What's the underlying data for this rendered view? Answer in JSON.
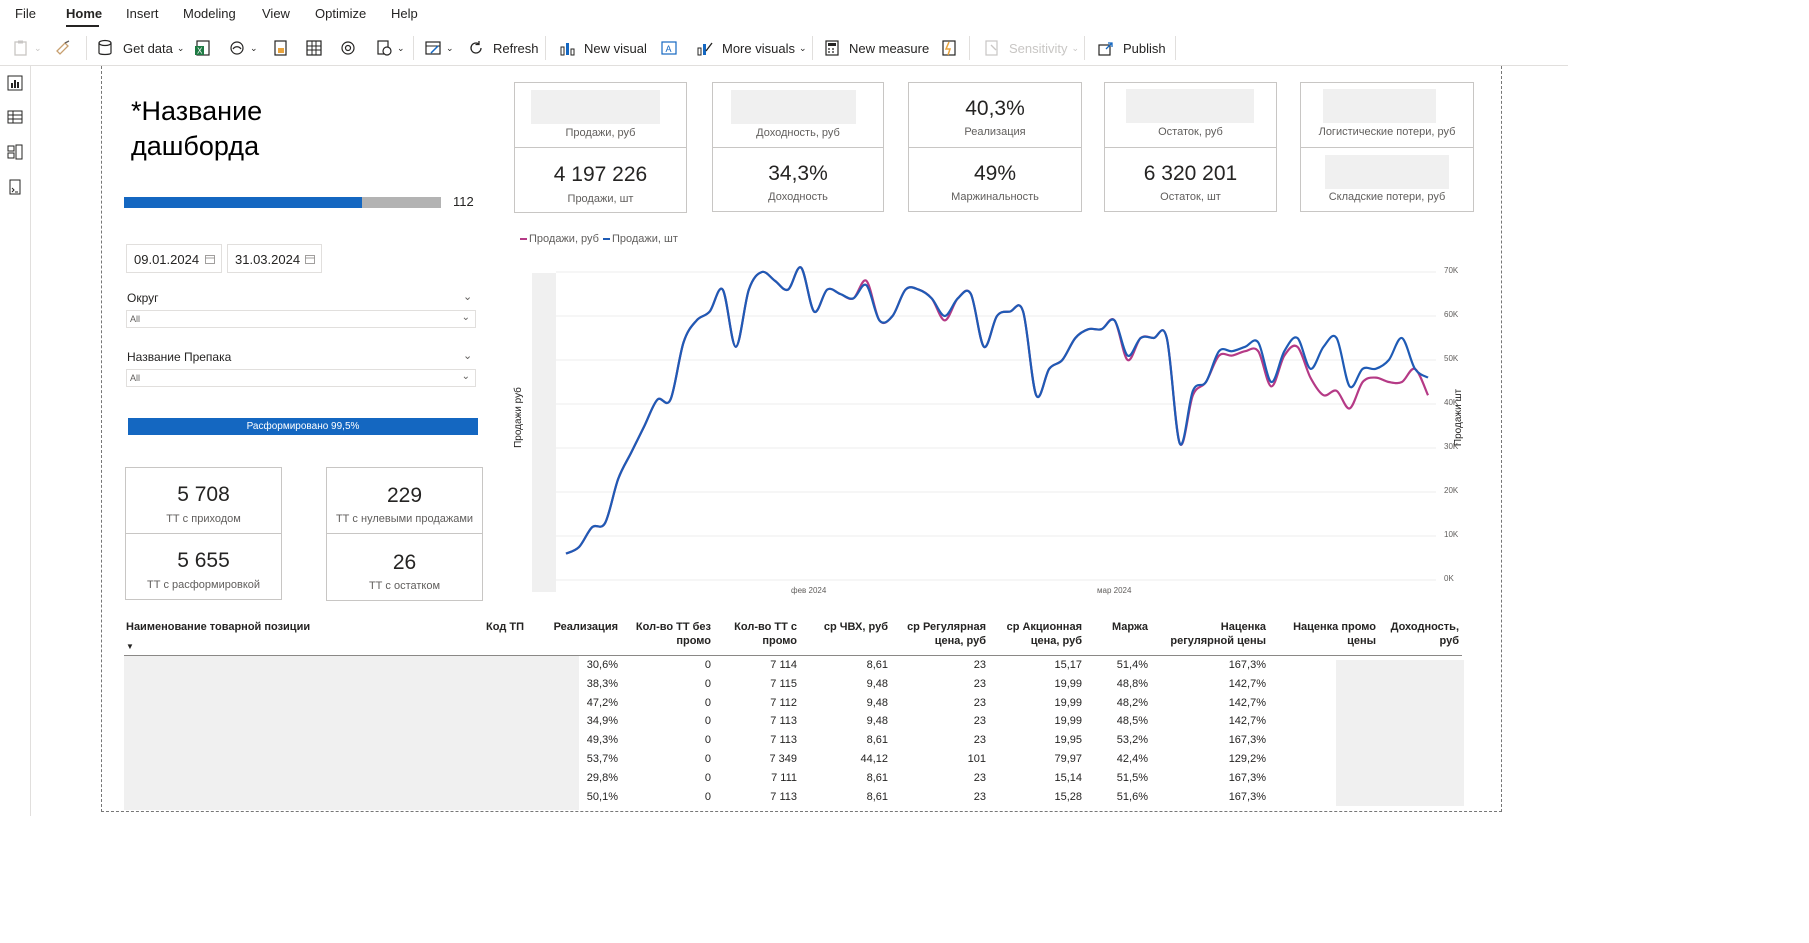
{
  "menu": {
    "file": "File",
    "home": "Home",
    "insert": "Insert",
    "modeling": "Modeling",
    "view": "View",
    "optimize": "Optimize",
    "help": "Help"
  },
  "toolbar": {
    "get_data": "Get data",
    "refresh": "Refresh",
    "new_visual": "New visual",
    "more_visuals": "More visuals",
    "new_measure": "New measure",
    "sensitivity": "Sensitivity",
    "publish": "Publish"
  },
  "dashboard": {
    "title": "*Название дашборда",
    "progress_value": "112",
    "progress_fraction": 0.75,
    "date_from": "09.01.2024",
    "date_to": "31.03.2024",
    "slicer_okrug": {
      "label": "Округ",
      "value": "All"
    },
    "slicer_preparat": {
      "label": "Название Препака",
      "value": "All"
    },
    "blue_bar": "Расформировано 99,5%"
  },
  "tt_cards": [
    {
      "value": "5 708",
      "label": "ТТ с приходом"
    },
    {
      "value": "5 655",
      "label": "ТТ с расформировкой"
    },
    {
      "value": "229",
      "label": "ТТ с нулевыми продажами"
    },
    {
      "value": "26",
      "label": "ТТ с остатком"
    }
  ],
  "kpi_cards": [
    {
      "top_value": "",
      "top_label": "Продажи, руб",
      "bottom_value": "4 197 226",
      "bottom_label": "Продажи, шт"
    },
    {
      "top_value": "",
      "top_label": "Доходность, руб",
      "bottom_value": "34,3%",
      "bottom_label": "Доходность"
    },
    {
      "top_value": "40,3%",
      "top_label": "Реализация",
      "bottom_value": "49%",
      "bottom_label": "Маржинальность"
    },
    {
      "top_value": "",
      "top_label": "Остаток, руб",
      "bottom_value": "6 320 201",
      "bottom_label": "Остаток, шт"
    },
    {
      "top_value": "",
      "top_label": "Логистические потери, руб",
      "bottom_value": "",
      "bottom_label": "Складские потери, руб"
    }
  ],
  "chart_data": {
    "type": "line",
    "legend": [
      "Продажи, руб",
      "Продажи, шт"
    ],
    "ylabel_left": "Продажи руб",
    "ylabel_right": "Продажи шт",
    "y_ticks": [
      "0K",
      "10K",
      "20K",
      "30K",
      "40K",
      "50K",
      "60K",
      "70K"
    ],
    "x_ticks": [
      "фев 2024",
      "мар 2024"
    ],
    "ylim_right": [
      0,
      70000
    ],
    "colors": {
      "series1": "#b53a86",
      "series2": "#1f5bb5"
    },
    "series": [
      {
        "name": "Продажи, руб",
        "values": [
          6000,
          7500,
          12000,
          13000,
          23000,
          29000,
          35000,
          41000,
          41000,
          54000,
          59000,
          61000,
          66000,
          53000,
          66000,
          70000,
          68000,
          66000,
          71000,
          61000,
          66000,
          65000,
          64000,
          68000,
          59000,
          60000,
          66000,
          66000,
          64000,
          59000,
          64000,
          65000,
          53000,
          60000,
          61000,
          61000,
          42000,
          48000,
          50000,
          55000,
          57000,
          57000,
          59000,
          50000,
          55000,
          55000,
          55000,
          31000,
          42000,
          45000,
          51000,
          51000,
          52000,
          52000,
          44000,
          51000,
          53000,
          46000,
          42000,
          43000,
          39000,
          45000,
          46000,
          45000,
          45000,
          48000,
          42000
        ]
      },
      {
        "name": "Продажи, шт",
        "values": [
          6000,
          7500,
          12000,
          13000,
          23000,
          29000,
          35000,
          41000,
          41000,
          54000,
          59000,
          61000,
          66000,
          53000,
          66000,
          70000,
          68000,
          66000,
          71000,
          61000,
          66000,
          65000,
          64000,
          67000,
          59000,
          60000,
          66000,
          66000,
          64000,
          60000,
          64000,
          65000,
          53000,
          60000,
          61000,
          61000,
          42000,
          48000,
          50000,
          55000,
          57000,
          57000,
          59000,
          51000,
          55000,
          55000,
          55000,
          31000,
          43000,
          45000,
          52000,
          52000,
          53000,
          54000,
          45000,
          52000,
          55000,
          48000,
          53000,
          55000,
          44000,
          48000,
          48000,
          50000,
          55000,
          48000,
          46000
        ]
      }
    ]
  },
  "table": {
    "headers": [
      "Наименование товарной позиции",
      "Код ТП",
      "Реализация",
      "Кол-во ТТ без промо",
      "Кол-во ТТ с промо",
      "ср ЧВХ, руб",
      "ср Регулярная цена, руб",
      "ср Акционная цена, руб",
      "Маржа",
      "Наценка регулярной цены",
      "Наценка промо цены",
      "Доходность, руб"
    ],
    "rows": [
      [
        "30,6%",
        "0",
        "7 114",
        "8,61",
        "23",
        "15,17",
        "51,4%",
        "167,3%"
      ],
      [
        "38,3%",
        "0",
        "7 115",
        "9,48",
        "23",
        "19,99",
        "48,8%",
        "142,7%"
      ],
      [
        "47,2%",
        "0",
        "7 112",
        "9,48",
        "23",
        "19,99",
        "48,2%",
        "142,7%"
      ],
      [
        "34,9%",
        "0",
        "7 113",
        "9,48",
        "23",
        "19,99",
        "48,5%",
        "142,7%"
      ],
      [
        "49,3%",
        "0",
        "7 113",
        "8,61",
        "23",
        "19,95",
        "53,2%",
        "167,3%"
      ],
      [
        "53,7%",
        "0",
        "7 349",
        "44,12",
        "101",
        "79,97",
        "42,4%",
        "129,2%"
      ],
      [
        "29,8%",
        "0",
        "7 111",
        "8,61",
        "23",
        "15,14",
        "51,5%",
        "167,3%"
      ],
      [
        "50,1%",
        "0",
        "7 113",
        "8,61",
        "23",
        "15,28",
        "51,6%",
        "167,3%"
      ]
    ]
  }
}
